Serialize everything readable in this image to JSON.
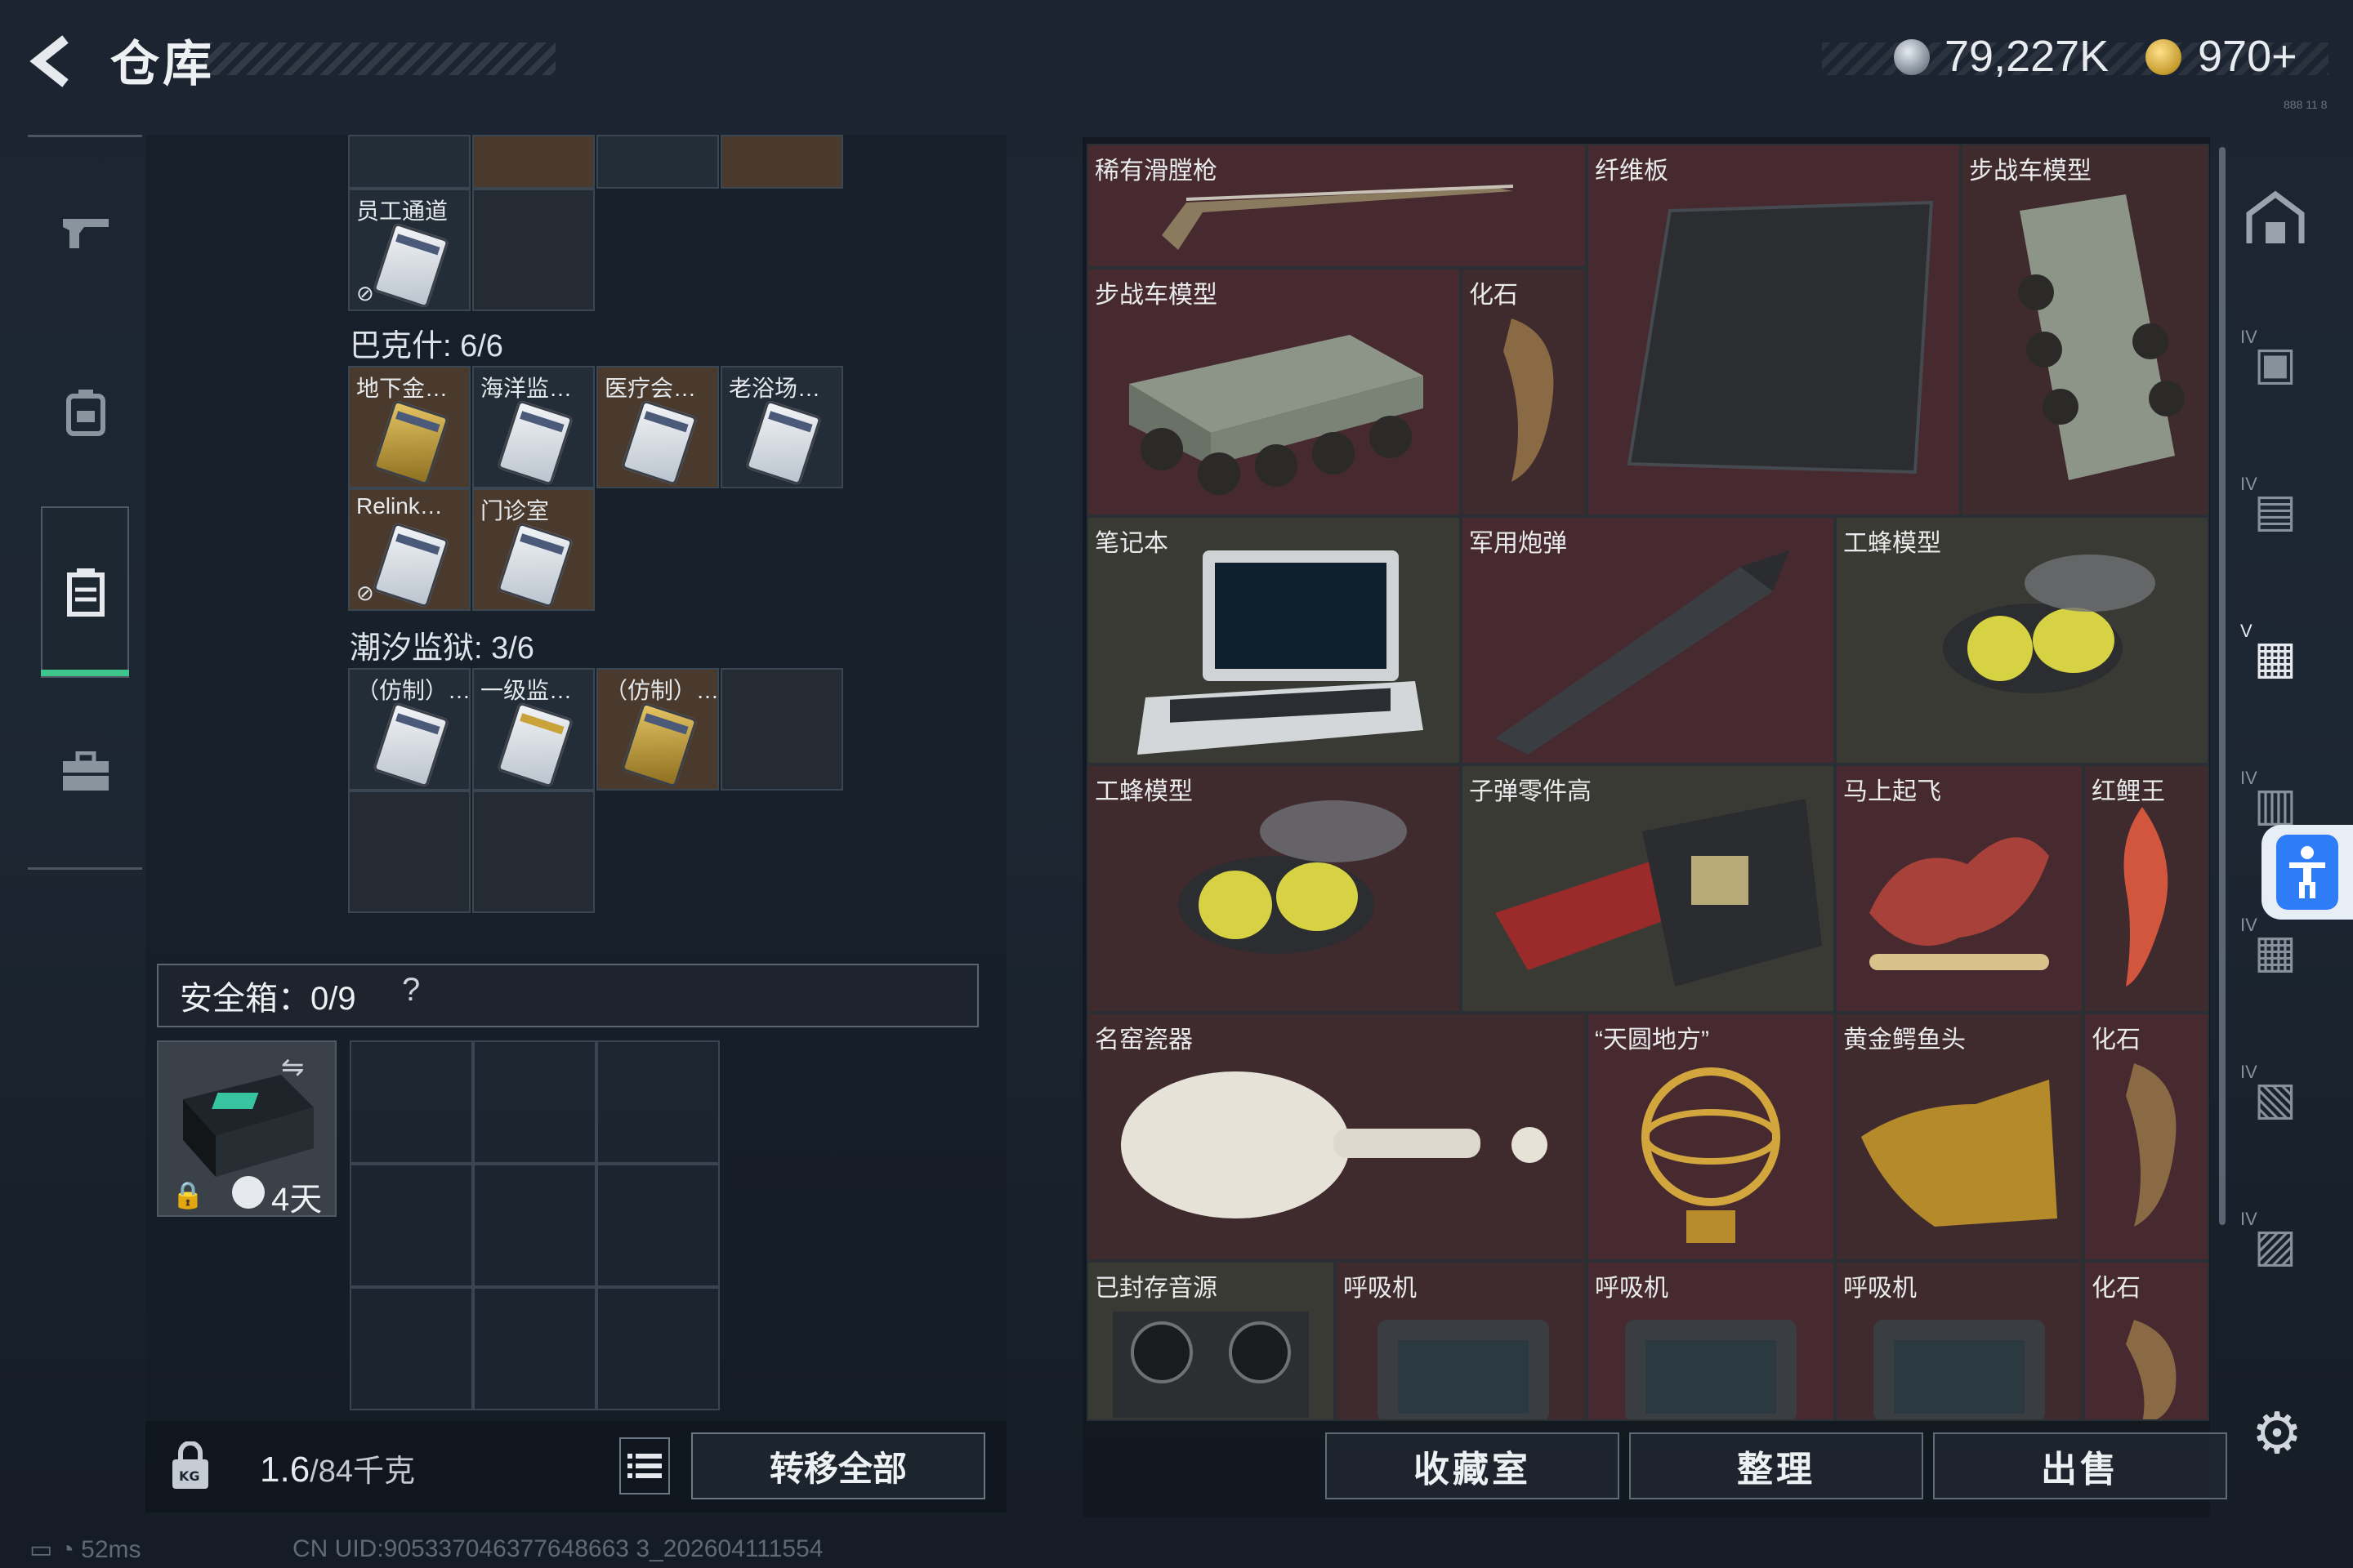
{
  "header": {
    "title": "仓库",
    "back_icon": "back-arrow-icon"
  },
  "currency": {
    "silver": "79,227K",
    "gold": "970+"
  },
  "left_nav": {
    "items": [
      {
        "name": "weapons",
        "icon": "gun-icon"
      },
      {
        "name": "equipment",
        "icon": "backpack-icon"
      },
      {
        "name": "containers",
        "icon": "container-icon",
        "active": true
      },
      {
        "name": "toolbox",
        "icon": "briefcase-icon"
      }
    ]
  },
  "container": {
    "top_partial_cells": 4,
    "staff_card": "员工通道",
    "bakshi": {
      "label": "巴克什: 6/6",
      "cells": [
        "地下金…",
        "海洋监…",
        "医疗会…",
        "老浴场…",
        "Relink…",
        "门诊室"
      ]
    },
    "tide_prison": {
      "label": "潮汐监狱: 3/6",
      "cells": [
        "（仿制）…",
        "一级监…",
        "（仿制）…"
      ]
    }
  },
  "safe_box": {
    "label": "安全箱：0/9",
    "help": "?",
    "timer": "4天"
  },
  "bottom_left": {
    "weight": "1.6",
    "capacity": "/84千克",
    "transfer_all": "转移全部"
  },
  "status": {
    "ping": "52ms",
    "uid": "CN UID:905337046377648663 3_202604111554"
  },
  "warehouse": {
    "items": [
      {
        "label": "稀有滑膛枪"
      },
      {
        "label": "纤维板"
      },
      {
        "label": "步战车模型"
      },
      {
        "label": "步战车模型"
      },
      {
        "label": "化石"
      },
      {
        "label": "笔记本"
      },
      {
        "label": "军用炮弹"
      },
      {
        "label": "工蜂模型"
      },
      {
        "label": "工蜂模型"
      },
      {
        "label": "子弹零件高"
      },
      {
        "label": "马上起飞"
      },
      {
        "label": "红鲤王"
      },
      {
        "label": "名窑瓷器"
      },
      {
        "label": "“天圆地方”"
      },
      {
        "label": "黄金鳄鱼头"
      },
      {
        "label": "化石"
      },
      {
        "label": "已封存音源"
      },
      {
        "label": "呼吸机"
      },
      {
        "label": "呼吸机"
      },
      {
        "label": "呼吸机"
      },
      {
        "label": "化石"
      }
    ]
  },
  "bottom_right": {
    "collection": "收藏室",
    "organize": "整理",
    "sell": "出售"
  },
  "right_rail": {
    "badges": [
      "IV",
      "IV",
      "V",
      "IV",
      "IV",
      "IV",
      "IV"
    ]
  },
  "version": "888 11 8"
}
